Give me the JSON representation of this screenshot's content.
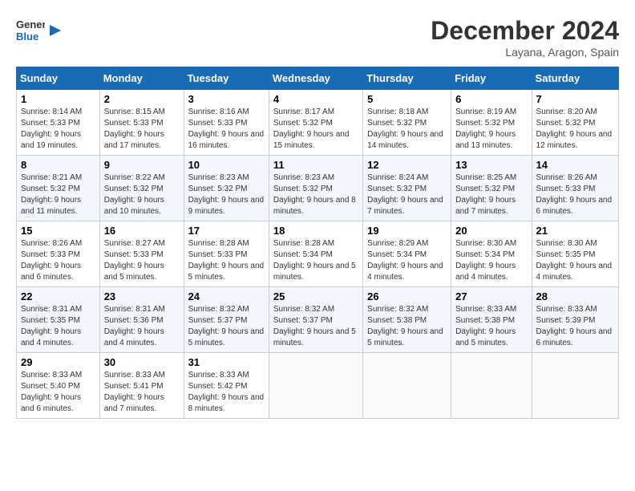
{
  "header": {
    "logo_line1": "General",
    "logo_line2": "Blue",
    "month": "December 2024",
    "location": "Layana, Aragon, Spain"
  },
  "columns": [
    "Sunday",
    "Monday",
    "Tuesday",
    "Wednesday",
    "Thursday",
    "Friday",
    "Saturday"
  ],
  "weeks": [
    [
      {
        "day": "1",
        "sunrise": "8:14 AM",
        "sunset": "5:33 PM",
        "daylight": "9 hours and 19 minutes."
      },
      {
        "day": "2",
        "sunrise": "8:15 AM",
        "sunset": "5:33 PM",
        "daylight": "9 hours and 17 minutes."
      },
      {
        "day": "3",
        "sunrise": "8:16 AM",
        "sunset": "5:33 PM",
        "daylight": "9 hours and 16 minutes."
      },
      {
        "day": "4",
        "sunrise": "8:17 AM",
        "sunset": "5:32 PM",
        "daylight": "9 hours and 15 minutes."
      },
      {
        "day": "5",
        "sunrise": "8:18 AM",
        "sunset": "5:32 PM",
        "daylight": "9 hours and 14 minutes."
      },
      {
        "day": "6",
        "sunrise": "8:19 AM",
        "sunset": "5:32 PM",
        "daylight": "9 hours and 13 minutes."
      },
      {
        "day": "7",
        "sunrise": "8:20 AM",
        "sunset": "5:32 PM",
        "daylight": "9 hours and 12 minutes."
      }
    ],
    [
      {
        "day": "8",
        "sunrise": "8:21 AM",
        "sunset": "5:32 PM",
        "daylight": "9 hours and 11 minutes."
      },
      {
        "day": "9",
        "sunrise": "8:22 AM",
        "sunset": "5:32 PM",
        "daylight": "9 hours and 10 minutes."
      },
      {
        "day": "10",
        "sunrise": "8:23 AM",
        "sunset": "5:32 PM",
        "daylight": "9 hours and 9 minutes."
      },
      {
        "day": "11",
        "sunrise": "8:23 AM",
        "sunset": "5:32 PM",
        "daylight": "9 hours and 8 minutes."
      },
      {
        "day": "12",
        "sunrise": "8:24 AM",
        "sunset": "5:32 PM",
        "daylight": "9 hours and 7 minutes."
      },
      {
        "day": "13",
        "sunrise": "8:25 AM",
        "sunset": "5:32 PM",
        "daylight": "9 hours and 7 minutes."
      },
      {
        "day": "14",
        "sunrise": "8:26 AM",
        "sunset": "5:33 PM",
        "daylight": "9 hours and 6 minutes."
      }
    ],
    [
      {
        "day": "15",
        "sunrise": "8:26 AM",
        "sunset": "5:33 PM",
        "daylight": "9 hours and 6 minutes."
      },
      {
        "day": "16",
        "sunrise": "8:27 AM",
        "sunset": "5:33 PM",
        "daylight": "9 hours and 5 minutes."
      },
      {
        "day": "17",
        "sunrise": "8:28 AM",
        "sunset": "5:33 PM",
        "daylight": "9 hours and 5 minutes."
      },
      {
        "day": "18",
        "sunrise": "8:28 AM",
        "sunset": "5:34 PM",
        "daylight": "9 hours and 5 minutes."
      },
      {
        "day": "19",
        "sunrise": "8:29 AM",
        "sunset": "5:34 PM",
        "daylight": "9 hours and 4 minutes."
      },
      {
        "day": "20",
        "sunrise": "8:30 AM",
        "sunset": "5:34 PM",
        "daylight": "9 hours and 4 minutes."
      },
      {
        "day": "21",
        "sunrise": "8:30 AM",
        "sunset": "5:35 PM",
        "daylight": "9 hours and 4 minutes."
      }
    ],
    [
      {
        "day": "22",
        "sunrise": "8:31 AM",
        "sunset": "5:35 PM",
        "daylight": "9 hours and 4 minutes."
      },
      {
        "day": "23",
        "sunrise": "8:31 AM",
        "sunset": "5:36 PM",
        "daylight": "9 hours and 4 minutes."
      },
      {
        "day": "24",
        "sunrise": "8:32 AM",
        "sunset": "5:37 PM",
        "daylight": "9 hours and 5 minutes."
      },
      {
        "day": "25",
        "sunrise": "8:32 AM",
        "sunset": "5:37 PM",
        "daylight": "9 hours and 5 minutes."
      },
      {
        "day": "26",
        "sunrise": "8:32 AM",
        "sunset": "5:38 PM",
        "daylight": "9 hours and 5 minutes."
      },
      {
        "day": "27",
        "sunrise": "8:33 AM",
        "sunset": "5:38 PM",
        "daylight": "9 hours and 5 minutes."
      },
      {
        "day": "28",
        "sunrise": "8:33 AM",
        "sunset": "5:39 PM",
        "daylight": "9 hours and 6 minutes."
      }
    ],
    [
      {
        "day": "29",
        "sunrise": "8:33 AM",
        "sunset": "5:40 PM",
        "daylight": "9 hours and 6 minutes."
      },
      {
        "day": "30",
        "sunrise": "8:33 AM",
        "sunset": "5:41 PM",
        "daylight": "9 hours and 7 minutes."
      },
      {
        "day": "31",
        "sunrise": "8:33 AM",
        "sunset": "5:42 PM",
        "daylight": "9 hours and 8 minutes."
      },
      null,
      null,
      null,
      null
    ]
  ],
  "labels": {
    "sunrise": "Sunrise:",
    "sunset": "Sunset:",
    "daylight": "Daylight:"
  }
}
